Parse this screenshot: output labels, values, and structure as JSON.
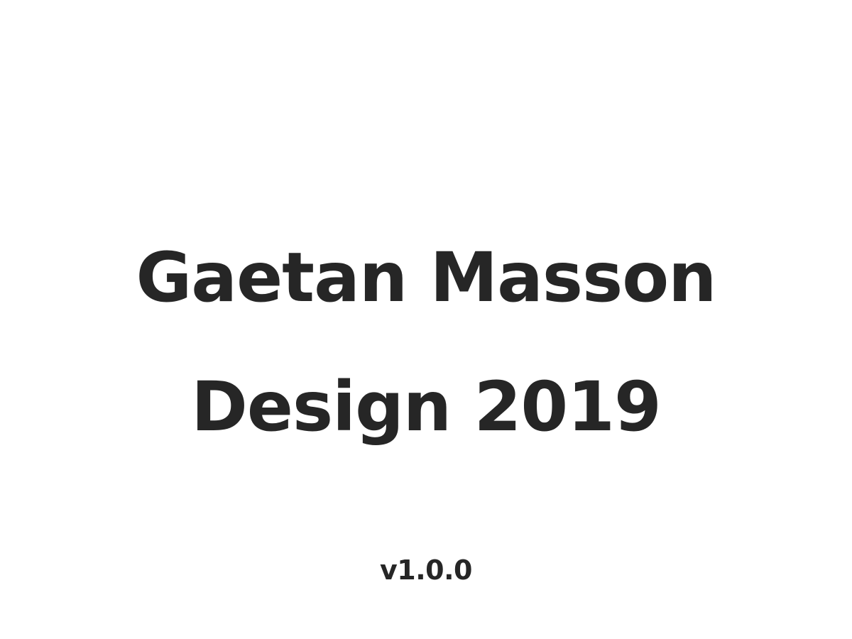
{
  "title": {
    "line1": "Gaetan Masson",
    "line2": "Design 2019"
  },
  "version": "v1.0.0",
  "colors": {
    "background": "#ffffff",
    "text": "#262626"
  }
}
